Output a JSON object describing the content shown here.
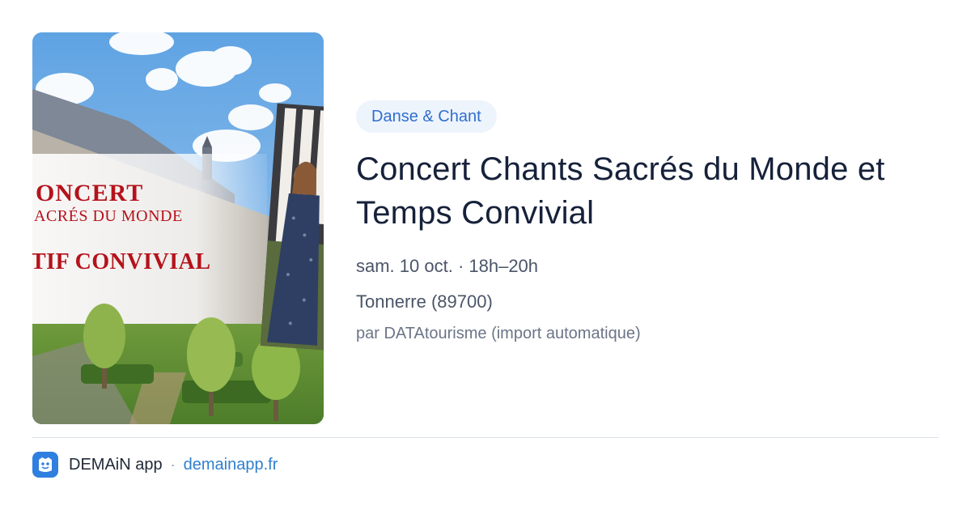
{
  "event_image": {
    "poster_line_1": "ONCERT",
    "poster_line_2": "ACRÉS DU MONDE",
    "poster_line_3": "TIF CONVIVIAL"
  },
  "event": {
    "category": "Danse & Chant",
    "title": "Concert Chants Sacrés du Monde et Temps Convivial",
    "datetime": "sam. 10 oct. · 18h–20h",
    "location": "Tonnerre (89700)",
    "source": "par DATAtourisme (import automatique)"
  },
  "footer": {
    "logo_icon": "demain-app-logo-icon",
    "app_name": "DEMAiN app",
    "separator": "·",
    "site_link": "demainapp.fr"
  },
  "colors": {
    "accent_blue": "#2f6fce",
    "chip_background": "#eef4fc",
    "title_text": "#16213a",
    "poster_red": "#b5121b"
  }
}
